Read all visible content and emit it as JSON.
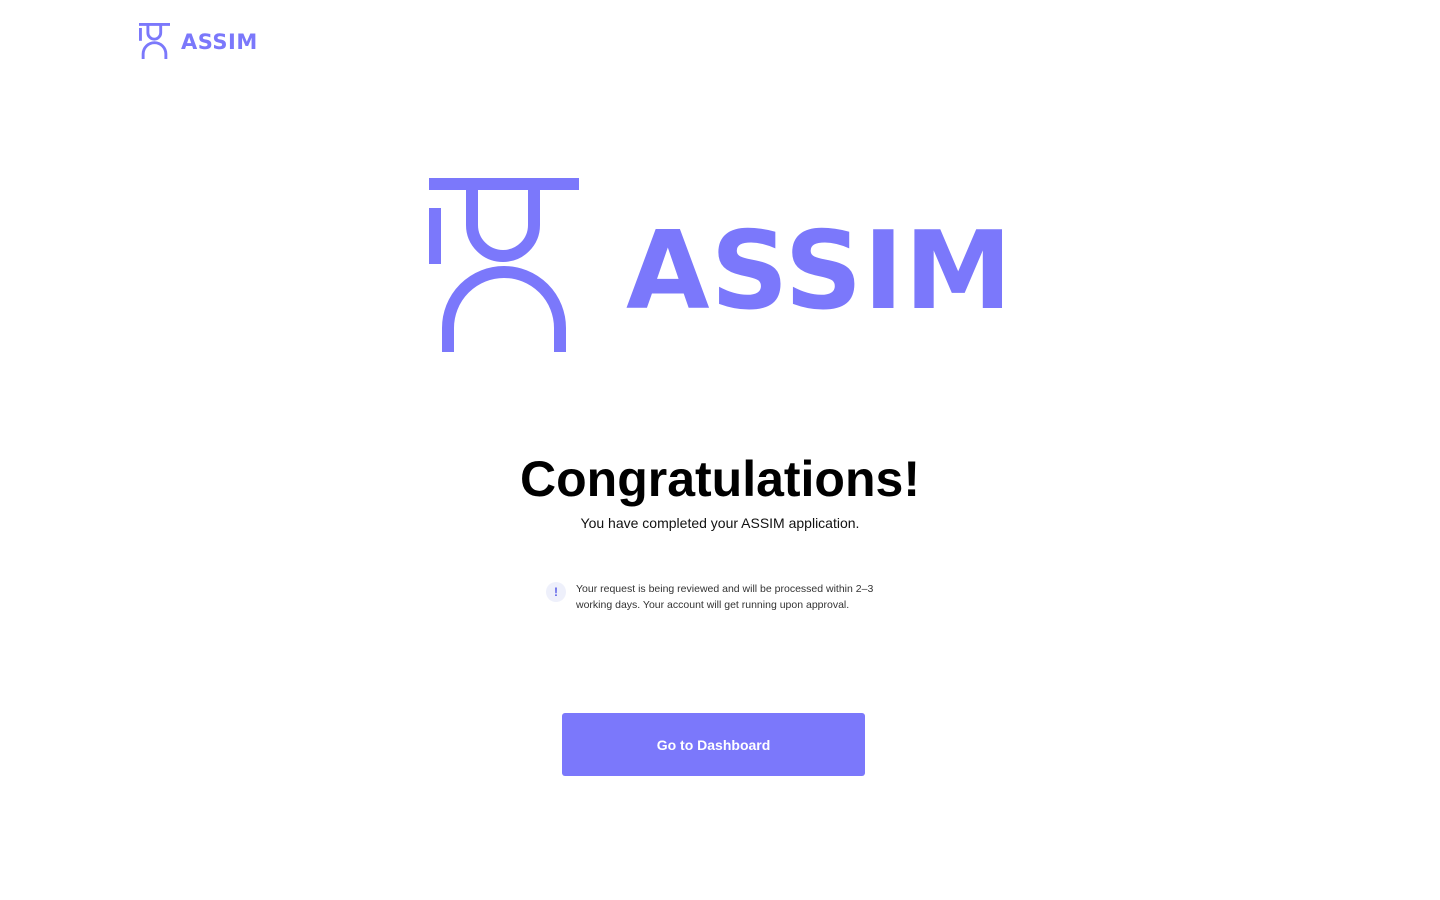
{
  "brand": {
    "name": "ASSIM",
    "color": "#7b78fb"
  },
  "header": {
    "logo_text": "ASSIM"
  },
  "hero": {
    "logo_text": "ASSIM"
  },
  "main": {
    "title": "Congratulations!",
    "subtitle": "You have completed your ASSIM application.",
    "notice": {
      "icon": "info-icon",
      "icon_glyph": "!",
      "text": "Your request is being reviewed and will be processed within 2–3 working days. Your account will get running upon approval."
    },
    "cta_label": "Go to Dashboard"
  }
}
